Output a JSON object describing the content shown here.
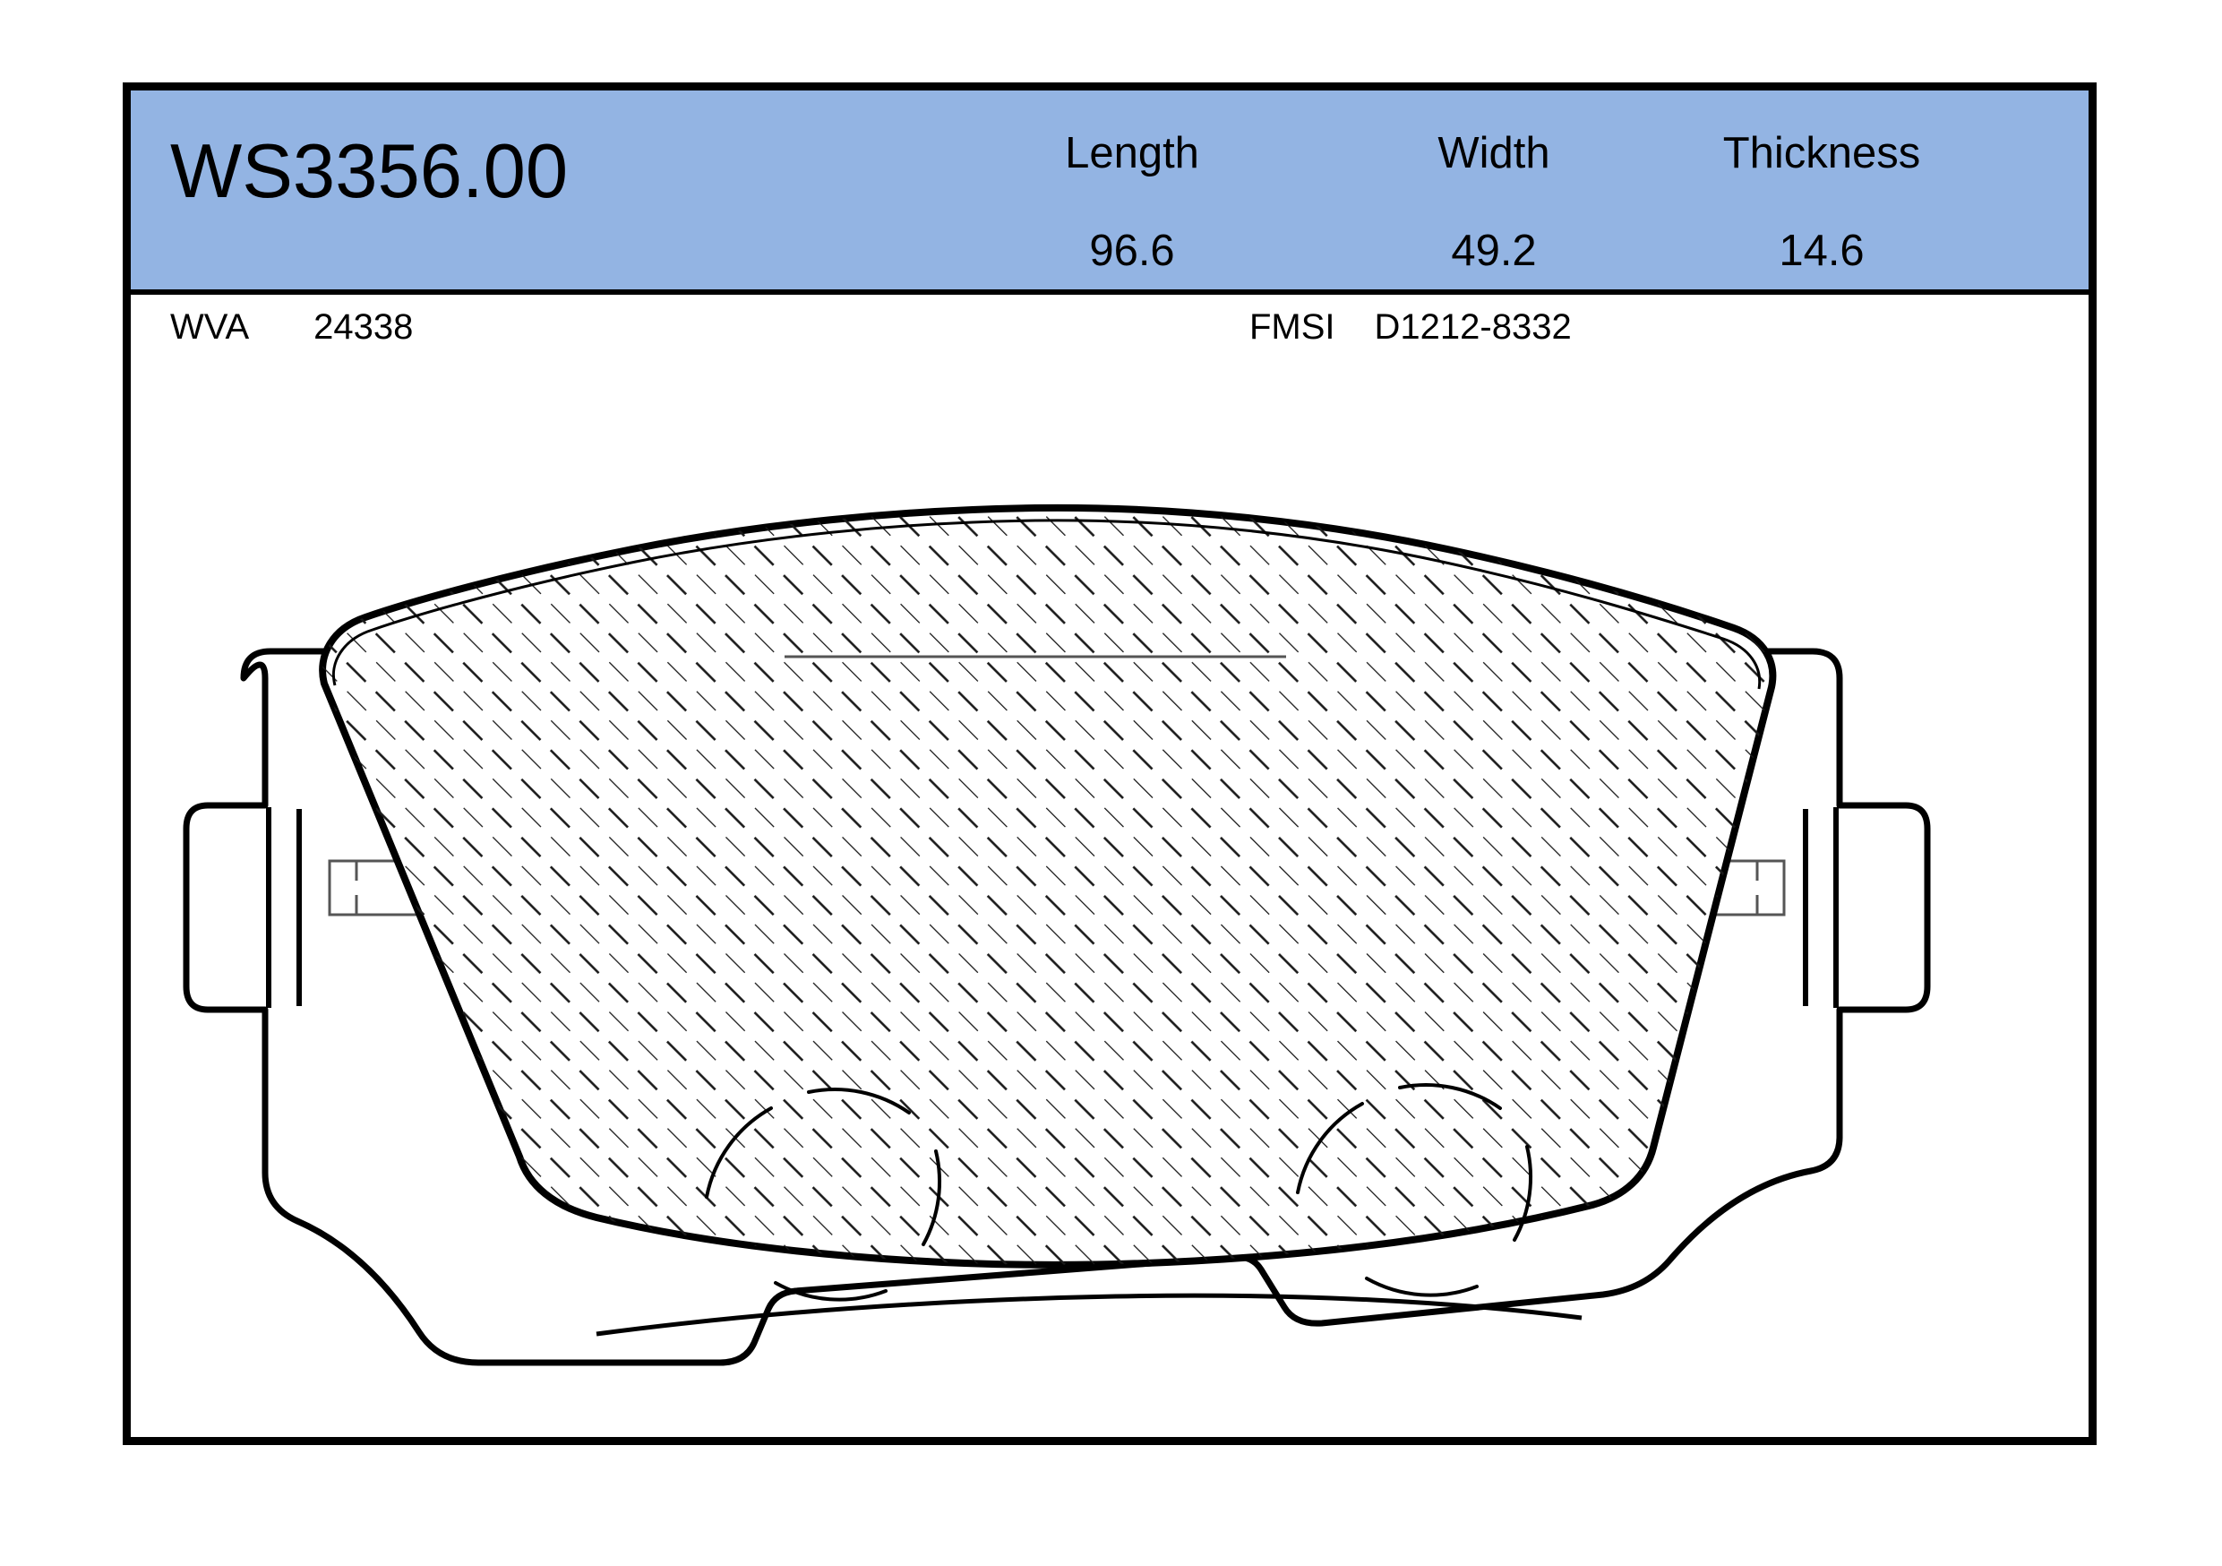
{
  "part": {
    "number": "WS3356.00"
  },
  "specs": [
    {
      "label": "Length",
      "value": "96.6"
    },
    {
      "label": "Width",
      "value": "49.2"
    },
    {
      "label": "Thickness",
      "value": "14.6"
    }
  ],
  "codes": {
    "wva_key": "WVA",
    "wva_value": "24338",
    "fmsi_key": "FMSI",
    "fmsi_value": "D1212-8332"
  },
  "colors": {
    "header_band": "#93b4e3",
    "border": "#000000",
    "sheet": "#ffffff",
    "line": "#000000",
    "hatch": "#1a1a1a"
  },
  "drawing": {
    "title": "brake-pad-technical-drawing",
    "description": "Front view of a disc brake pad: steel backing plate with two side ears, two rounded locating tabs on the upper edge, stepped lower edge, and a hatched friction-material block with two broken-circle rivet indications."
  }
}
